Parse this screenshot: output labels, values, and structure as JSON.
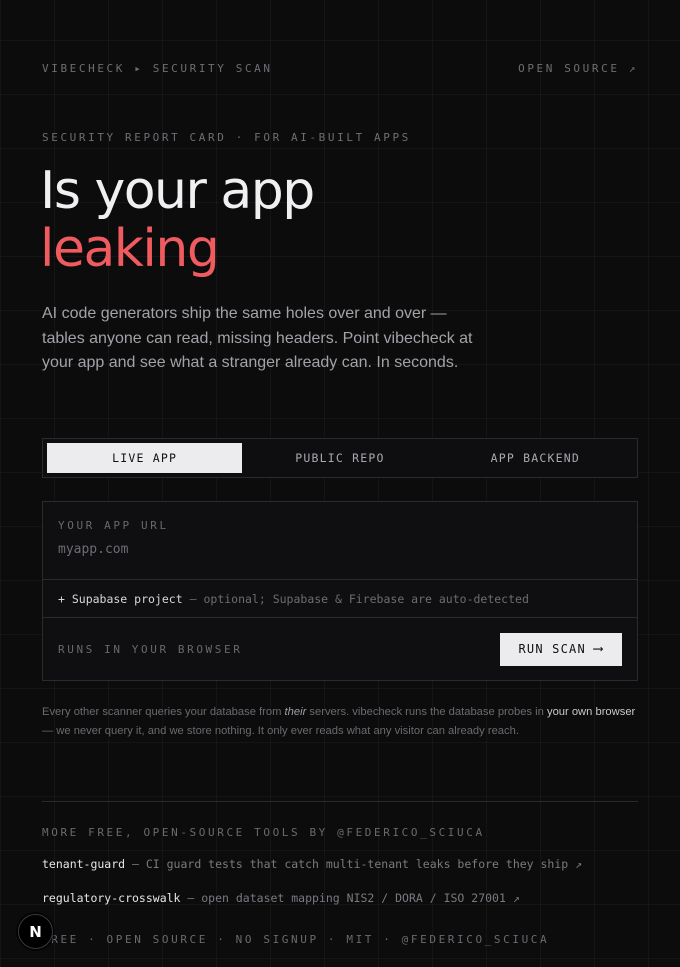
{
  "nav": {
    "brand": "VIBECHECK",
    "separator": "▸",
    "section": "SECURITY SCAN",
    "open_source": "OPEN SOURCE ↗"
  },
  "hero": {
    "eyebrow": "SECURITY REPORT CARD · FOR AI-BUILT APPS",
    "headline_line1": "Is your app",
    "headline_line2": "leaking",
    "lead": "AI code generators ship the same holes over and over — tables anyone can read, missing headers. Point vibecheck at your app and see what a stranger already can. In seconds."
  },
  "tabs": [
    {
      "label": "LIVE APP",
      "active": true
    },
    {
      "label": "PUBLIC REPO",
      "active": false
    },
    {
      "label": "APP BACKEND",
      "active": false
    }
  ],
  "scan_form": {
    "url_label": "YOUR APP URL",
    "url_value": "",
    "url_placeholder": "myapp.com",
    "supabase_toggle": "+ Supabase project",
    "supabase_note": "— optional; Supabase & Firebase are auto-detected",
    "runs_hint": "RUNS IN YOUR BROWSER",
    "run_button": "RUN SCAN",
    "run_arrow": "⟶"
  },
  "privacy_note": {
    "part1": "Every other scanner queries your database from ",
    "their": "their",
    "part2": " servers. vibecheck runs the database probes in ",
    "highlight": "your own browser",
    "part3": " — we never query it, and we store nothing. It only ever reads what any visitor can already reach."
  },
  "more_tools": {
    "label": "MORE FREE, OPEN-SOURCE TOOLS BY @FEDERICO_SCIUCA",
    "items": [
      {
        "name": "tenant-guard",
        "description": " — CI guard tests that catch multi-tenant leaks before they ship ",
        "arrow": "↗"
      },
      {
        "name": "regulatory-crosswalk",
        "description": " — open dataset mapping NIS2 / DORA / ISO 27001 ",
        "arrow": "↗"
      }
    ]
  },
  "footer": {
    "text": "FREE · OPEN SOURCE · NO SIGNUP · MIT · @FEDERICO_SCIUCA"
  },
  "dev_badge": {
    "letter": "N"
  },
  "colors": {
    "background": "#0c0c0d",
    "accent_red": "#ef5b5e",
    "text_primary": "#f0f0f2",
    "text_muted": "#6e6e74",
    "button_bg": "#ececee"
  }
}
